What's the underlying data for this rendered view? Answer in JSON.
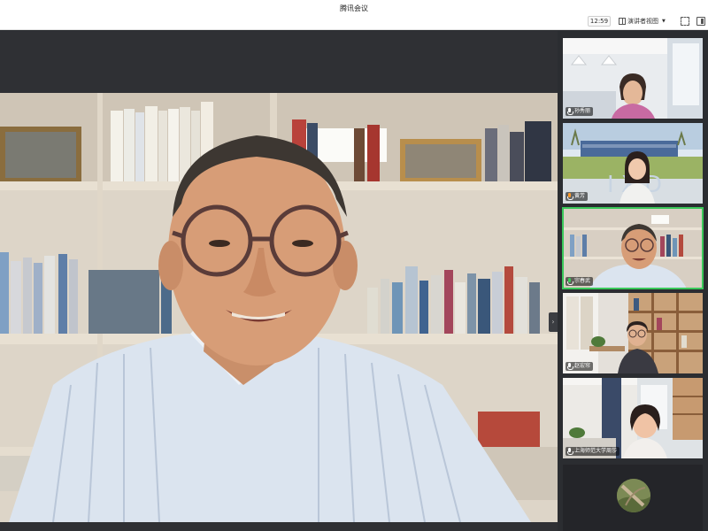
{
  "window": {
    "title": "腾讯会议"
  },
  "toolbar": {
    "timer": "12:59",
    "view_label": "演讲者视图",
    "icons": {
      "view": "grid-view-icon",
      "fullscreen": "fullscreen-icon",
      "panel": "side-panel-icon"
    }
  },
  "main_video": {
    "speaker": "main-speaker"
  },
  "participants": [
    {
      "name": "孙秀丽",
      "mic": "mic-icon"
    },
    {
      "name": "黄芳",
      "mic": "mic-icon"
    },
    {
      "name": "宗春武",
      "mic": "mic-speaking-icon",
      "active": true
    },
    {
      "name": "赵宏帘",
      "mic": "mic-icon"
    },
    {
      "name": "上海师范大学周莎",
      "mic": "mic-icon"
    }
  ],
  "colors": {
    "active_speaker_border": "#3ac85a",
    "muted": "#ff5a5a"
  }
}
